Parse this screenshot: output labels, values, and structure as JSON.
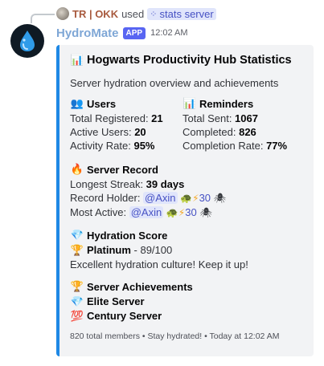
{
  "reply": {
    "user": "TR | OKK",
    "used_text": "used",
    "command": "stats server",
    "command_icon": "slash-command-icon"
  },
  "header": {
    "bot_name": "HydroMate",
    "badge": "APP",
    "time": "12:02 AM"
  },
  "embed": {
    "accent_color": "#1e88e5",
    "title_icon": "📊",
    "title": "Hogwarts Productivity Hub Statistics",
    "description": "Server hydration overview and achievements",
    "users": {
      "icon": "👥",
      "title": "Users",
      "rows": [
        {
          "label": "Total Registered: ",
          "value": "21"
        },
        {
          "label": "Active Users: ",
          "value": "20"
        },
        {
          "label": "Activity Rate: ",
          "value": "95%"
        }
      ]
    },
    "reminders": {
      "icon": "📊",
      "title": "Reminders",
      "rows": [
        {
          "label": "Total Sent: ",
          "value": "1067"
        },
        {
          "label": "Completed: ",
          "value": "826"
        },
        {
          "label": "Completion Rate: ",
          "value": "77%"
        }
      ]
    },
    "record": {
      "icon": "🔥",
      "title": "Server Record",
      "streak_label": "Longest Streak: ",
      "streak_value": "39 days",
      "holder_label": "Record Holder: ",
      "holder_mention": "@Axin",
      "holder_level": "30",
      "active_label": "Most Active: ",
      "active_mention": "@Axin",
      "active_level": "30"
    },
    "score": {
      "icon": "💎",
      "title": "Hydration Score",
      "tier_icon": "🏆",
      "tier": "Platinum",
      "points": " - 89/100",
      "message": "Excellent hydration culture! Keep it up!"
    },
    "achievements": {
      "icon": "🏆",
      "title": "Server Achievements",
      "items": [
        {
          "icon": "💎",
          "label": "Elite Server"
        },
        {
          "icon": "💯",
          "label": "Century Server"
        }
      ]
    },
    "footer": "820 total members • Stay hydrated! • Today at 12:02 AM"
  }
}
